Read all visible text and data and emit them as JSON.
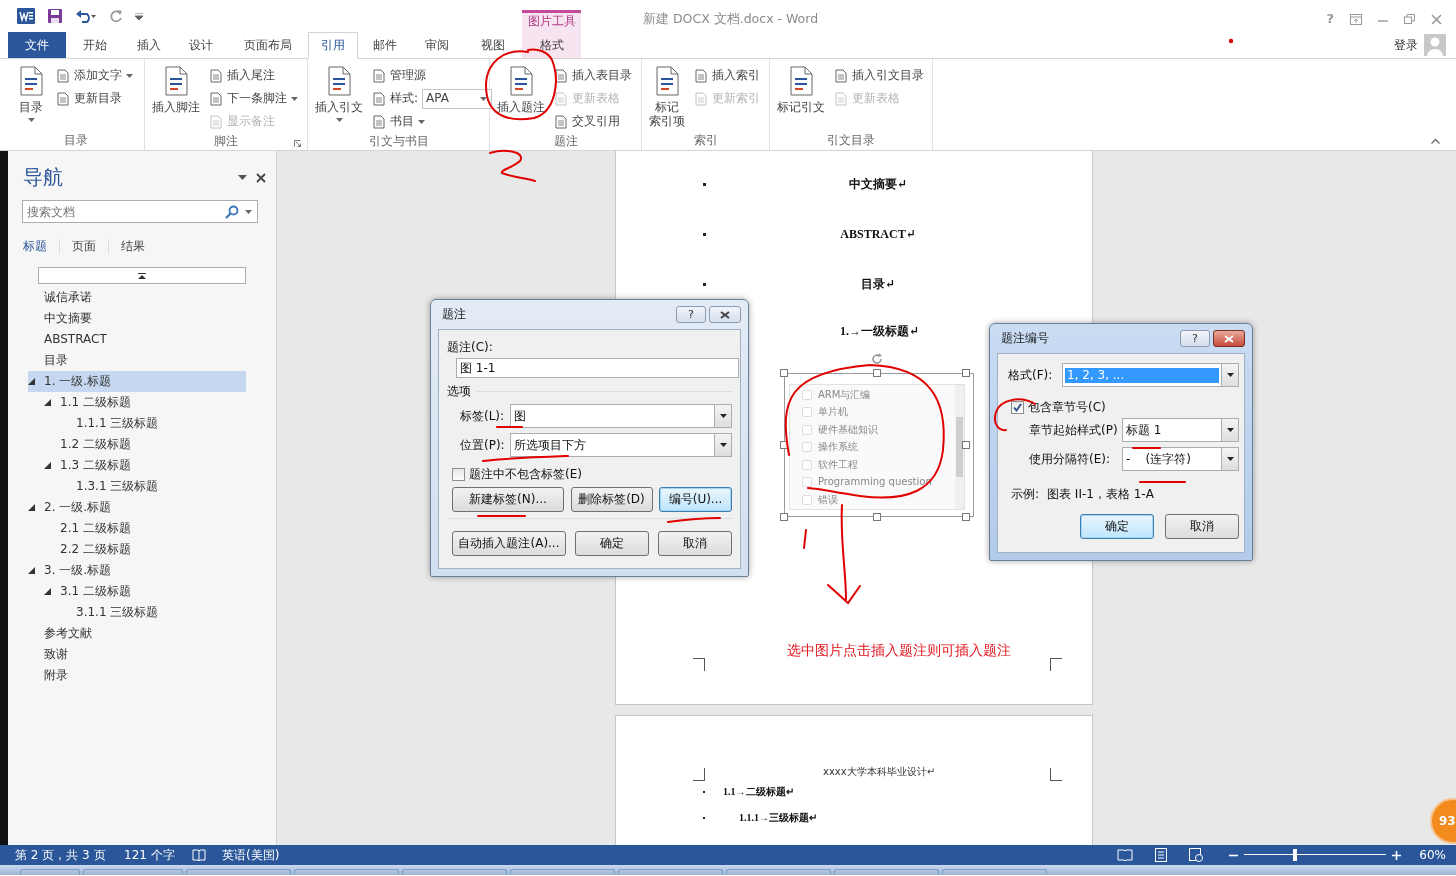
{
  "title_bar": {
    "title": "新建 DOCX 文档.docx - Word",
    "context_group": "图片工具",
    "help": "?"
  },
  "tabs": [
    {
      "label": "文件",
      "kind": "file",
      "selected": false
    },
    {
      "label": "开始",
      "kind": "tab",
      "selected": false
    },
    {
      "label": "插入",
      "kind": "tab",
      "selected": false
    },
    {
      "label": "设计",
      "kind": "tab",
      "selected": false
    },
    {
      "label": "页面布局",
      "kind": "tab",
      "selected": false
    },
    {
      "label": "引用",
      "kind": "tab",
      "selected": true
    },
    {
      "label": "邮件",
      "kind": "tab",
      "selected": false
    },
    {
      "label": "审阅",
      "kind": "tab",
      "selected": false
    },
    {
      "label": "视图",
      "kind": "tab",
      "selected": false
    },
    {
      "label": "格式",
      "kind": "context",
      "selected": false
    }
  ],
  "account": "登录",
  "ribbon_groups": [
    {
      "label": "目录",
      "launcher": false,
      "columns": [
        [
          {
            "kind": "large",
            "label": "目录",
            "dropdown": true,
            "disabled": false
          }
        ],
        [
          {
            "kind": "small",
            "label": "添加文字",
            "dropdown": true,
            "disabled": false
          },
          {
            "kind": "small",
            "label": "更新目录",
            "dropdown": false,
            "disabled": false
          }
        ]
      ]
    },
    {
      "label": "脚注",
      "launcher": true,
      "columns": [
        [
          {
            "kind": "large",
            "label": "插入脚注",
            "dropdown": false,
            "disabled": false
          }
        ],
        [
          {
            "kind": "small",
            "label": "插入尾注",
            "dropdown": false,
            "disabled": false
          },
          {
            "kind": "small",
            "label": "下一条脚注",
            "dropdown": true,
            "disabled": false
          },
          {
            "kind": "small",
            "label": "显示备注",
            "dropdown": false,
            "disabled": true
          }
        ]
      ]
    },
    {
      "label": "引文与书目",
      "launcher": false,
      "columns": [
        [
          {
            "kind": "large",
            "label": "插入引文",
            "dropdown": true,
            "disabled": false
          }
        ],
        [
          {
            "kind": "small",
            "label": "管理源",
            "dropdown": false,
            "disabled": false
          },
          {
            "kind": "combo",
            "label": "样式:",
            "value": "APA",
            "dropdown": true,
            "disabled": false
          },
          {
            "kind": "small",
            "label": "书目",
            "dropdown": true,
            "disabled": false
          }
        ]
      ]
    },
    {
      "label": "题注",
      "launcher": false,
      "columns": [
        [
          {
            "kind": "large",
            "label": "插入题注",
            "dropdown": false,
            "disabled": false
          }
        ],
        [
          {
            "kind": "small",
            "label": "插入表目录",
            "dropdown": false,
            "disabled": false
          },
          {
            "kind": "small",
            "label": "更新表格",
            "dropdown": false,
            "disabled": true
          },
          {
            "kind": "small",
            "label": "交叉引用",
            "dropdown": false,
            "disabled": false
          }
        ]
      ]
    },
    {
      "label": "索引",
      "launcher": false,
      "columns": [
        [
          {
            "kind": "large",
            "lines": [
              "标记",
              "索引项"
            ],
            "dropdown": false,
            "disabled": false
          }
        ],
        [
          {
            "kind": "small",
            "label": "插入索引",
            "dropdown": false,
            "disabled": false
          },
          {
            "kind": "small",
            "label": "更新索引",
            "dropdown": false,
            "disabled": true
          }
        ]
      ]
    },
    {
      "label": "引文目录",
      "launcher": false,
      "columns": [
        [
          {
            "kind": "large",
            "label": "标记引文",
            "dropdown": false,
            "disabled": false
          }
        ],
        [
          {
            "kind": "small",
            "label": "插入引文目录",
            "dropdown": false,
            "disabled": false
          },
          {
            "kind": "small",
            "label": "更新表格",
            "dropdown": false,
            "disabled": true
          }
        ]
      ]
    }
  ],
  "navigation": {
    "title": "导航",
    "search_placeholder": "搜索文档",
    "tabs": [
      {
        "label": "标题",
        "selected": true
      },
      {
        "label": "页面",
        "selected": false
      },
      {
        "label": "结果",
        "selected": false
      }
    ],
    "headings": [
      {
        "text": "诚信承诺",
        "selected": false
      },
      {
        "text": "中文摘要",
        "selected": false
      },
      {
        "text": "ABSTRACT",
        "selected": false
      },
      {
        "text": "目录",
        "selected": false
      },
      {
        "text": "1. 一级.标题",
        "selected": true,
        "expanded": true,
        "children": [
          {
            "text": "1.1 二级标题",
            "selected": false,
            "expanded": true,
            "children": [
              {
                "text": "1.1.1 三级标题",
                "selected": false
              }
            ]
          },
          {
            "text": "1.2 二级标题",
            "selected": false
          },
          {
            "text": "1.3 二级标题",
            "selected": false,
            "expanded": true,
            "children": [
              {
                "text": "1.3.1 三级标题",
                "selected": false
              }
            ]
          }
        ]
      },
      {
        "text": "2. 一级.标题",
        "selected": false,
        "expanded": true,
        "children": [
          {
            "text": "2.1 二级标题",
            "selected": false
          },
          {
            "text": "2.2 二级标题",
            "selected": false
          }
        ]
      },
      {
        "text": "3. 一级.标题",
        "selected": false,
        "expanded": true,
        "children": [
          {
            "text": "3.1 二级标题",
            "selected": false,
            "expanded": true,
            "children": [
              {
                "text": "3.1.1 三级标题",
                "selected": false
              }
            ]
          }
        ]
      },
      {
        "text": "参考文献",
        "selected": false
      },
      {
        "text": "致谢",
        "selected": false
      },
      {
        "text": "附录",
        "selected": false
      }
    ]
  },
  "document": {
    "page_1": [
      {
        "text": "中文摘要↵",
        "bullet": true
      },
      {
        "text": "ABSTRACT↵",
        "bullet": true
      },
      {
        "text": "目录↵",
        "bullet": true
      },
      {
        "text": "1.→一级标题↵",
        "bullet": false
      }
    ],
    "image_list": [
      {
        "label": "ARM与汇编",
        "checked": false
      },
      {
        "label": "单片机",
        "checked": false
      },
      {
        "label": "硬件基础知识",
        "checked": false
      },
      {
        "label": "操作系统",
        "checked": false
      },
      {
        "label": "软件工程",
        "checked": false
      },
      {
        "label": "Programming question",
        "checked": false
      },
      {
        "label": "错误",
        "checked": false
      }
    ],
    "note": "选中图片点击插入题注则可插入题注",
    "page_2": {
      "header": "xxxx大学本科毕业设计↵",
      "lines": [
        {
          "text": "1.1→二级标题↵",
          "bullet": true
        },
        {
          "text": "1.1.1→三级标题↵",
          "bullet": true
        }
      ]
    }
  },
  "caption_dialog": {
    "title": "题注",
    "active": false,
    "help": "?",
    "caption_label": "题注(C):",
    "caption_value": "图 1-1",
    "options_label": "选项",
    "label_field": {
      "label": "标签(L):",
      "value": "图"
    },
    "position_field": {
      "label": "位置(P):",
      "value": "所选项目下方"
    },
    "exclude_label": {
      "label": "题注中不包含标签(E)",
      "checked": false
    },
    "buttons": [
      {
        "label": "新建标签(N)...",
        "focused": false
      },
      {
        "label": "删除标签(D)",
        "focused": false
      },
      {
        "label": "编号(U)...",
        "focused": true
      },
      {
        "label": "自动插入题注(A)...",
        "focused": false
      },
      {
        "label": "确定",
        "focused": false
      },
      {
        "label": "取消",
        "focused": false
      }
    ]
  },
  "numbering_dialog": {
    "title": "题注编号",
    "active": true,
    "help": "?",
    "format": {
      "label": "格式(F):",
      "value": "1, 2, 3, ...",
      "selected": true
    },
    "include_chapter": {
      "label": "包含章节号(C)",
      "checked": true
    },
    "chapter_style": {
      "label": "章节起始样式(P)",
      "value": "标题 1"
    },
    "separator": {
      "label": "使用分隔符(E):",
      "value": "-    (连字符)"
    },
    "example_label": "示例:",
    "example": "图表 II-1，表格 1-A",
    "buttons": [
      {
        "label": "确定",
        "focused": true
      },
      {
        "label": "取消",
        "focused": false
      }
    ]
  },
  "status_bar": {
    "page": "第 2 页，共 3 页",
    "words": "121 个字",
    "language": "英语(美国)",
    "zoom": "60%",
    "zoom_slider": {
      "level": 0.36
    }
  },
  "badge": "93"
}
